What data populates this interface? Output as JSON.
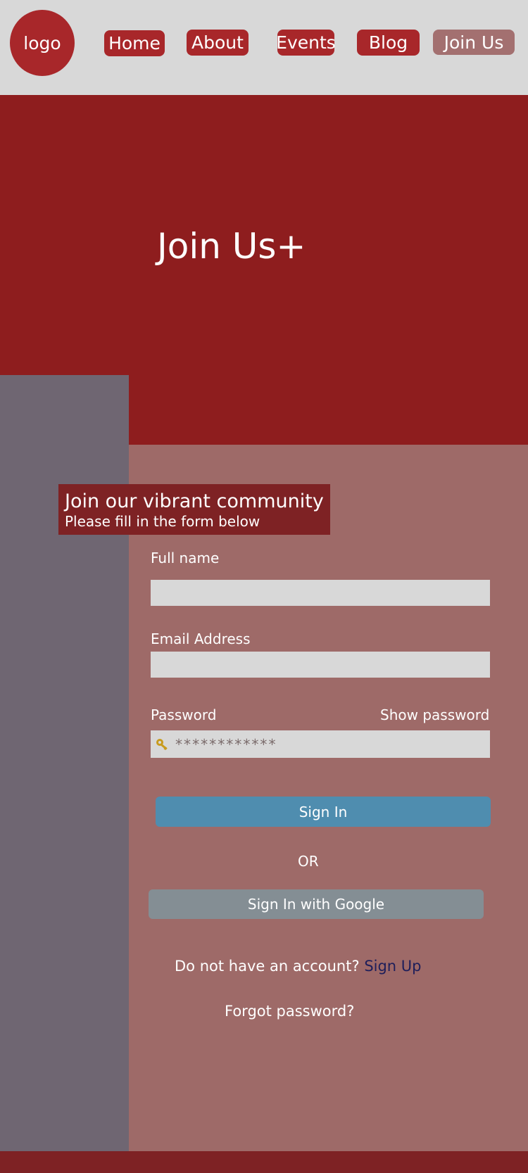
{
  "header": {
    "logo": "logo",
    "nav": [
      {
        "label": "Home"
      },
      {
        "label": "About"
      },
      {
        "label": "Events"
      },
      {
        "label": "Blog"
      },
      {
        "label": "Join Us",
        "active": true
      }
    ]
  },
  "hero": {
    "title": "Join Us+"
  },
  "intro": {
    "title": "Join our vibrant community",
    "subtitle": "Please fill in the form below"
  },
  "form": {
    "full_name_label": "Full name",
    "full_name_value": "",
    "email_label": "Email Address",
    "email_value": "",
    "password_label": "Password",
    "show_password_label": "Show password",
    "password_value": "************",
    "password_icon": "key-icon",
    "sign_in_label": "Sign In",
    "or_label": "OR",
    "google_label": "Sign In with Google",
    "no_account_text": "Do not have an account?",
    "sign_up_link": "Sign Up",
    "forgot_password": "Forgot password?"
  },
  "colors": {
    "header_bg": "#d8d8d8",
    "nav_button": "#a8272a",
    "nav_active": "#a37070",
    "hero_bg": "#8e1d1e",
    "side_panel": "#6f6672",
    "form_panel": "#9e6a68",
    "sign_in_button": "#4f8daf",
    "google_button": "#848e94",
    "footer": "#7e2224"
  }
}
